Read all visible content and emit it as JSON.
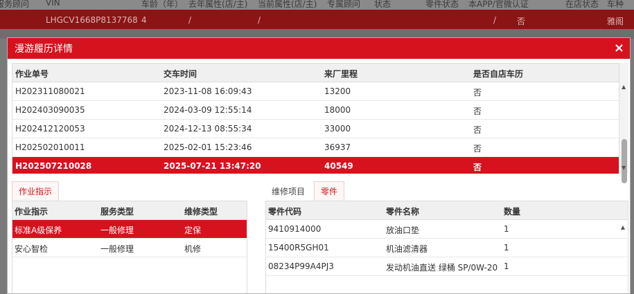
{
  "background": {
    "header_cols": [
      "服务顾问",
      "VIN",
      "车龄（年）",
      "去年属性(店/主)",
      "当前属性(店/主)",
      "专属顾问",
      "状态",
      "零件状态",
      "本APP/官微认证",
      "在店状态",
      "车种"
    ],
    "row": {
      "vin": "LHGCV1668P8137768",
      "age": "4",
      "last_attr": "/",
      "cur_attr": "/",
      "app_attr": "/",
      "app_value": "否",
      "model": "雅阁"
    }
  },
  "modal": {
    "title": "漫游履历详情",
    "close_icon": "×"
  },
  "history": {
    "columns": [
      "作业单号",
      "交车时间",
      "来厂里程",
      "是否自店车历"
    ],
    "rows": [
      {
        "order": "H202311080021",
        "time": "2023-11-08 16:09:43",
        "mileage": "13200",
        "own": "否"
      },
      {
        "order": "H202403090035",
        "time": "2024-03-09 12:55:14",
        "mileage": "18000",
        "own": "否"
      },
      {
        "order": "H202412120053",
        "time": "2024-12-13 08:55:34",
        "mileage": "33000",
        "own": "否"
      },
      {
        "order": "H202502010011",
        "time": "2025-02-01 15:23:46",
        "mileage": "36937",
        "own": "否"
      },
      {
        "order": "H202507210028",
        "time": "2025-07-21 13:47:20",
        "mileage": "40549",
        "own": "否"
      }
    ]
  },
  "instructions": {
    "tab_label": "作业指示",
    "columns": [
      "作业指示",
      "服务类型",
      "维修类型"
    ],
    "rows": [
      {
        "name": "标准A级保养",
        "service": "一般修理",
        "repair": "定保"
      },
      {
        "name": "安心智检",
        "service": "一般修理",
        "repair": "机修"
      }
    ]
  },
  "parts": {
    "tabs": [
      "维修项目",
      "零件"
    ],
    "columns": [
      "零件代码",
      "零件名称",
      "数量"
    ],
    "rows": [
      {
        "code": "9410914000",
        "name": "放油口垫",
        "qty": "1"
      },
      {
        "code": "15400R5GH01",
        "name": "机油滤清器",
        "qty": "1"
      },
      {
        "code": "08234P99A4PJ3",
        "name": "发动机油直送 绿桶 SP/0W-20",
        "qty": "1"
      }
    ]
  }
}
